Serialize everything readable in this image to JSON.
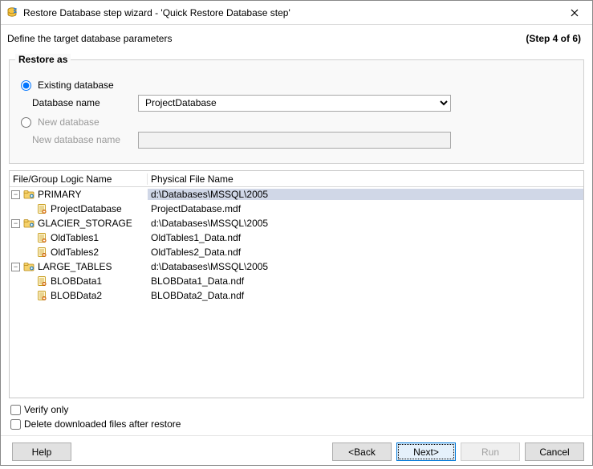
{
  "window": {
    "title": "Restore Database step wizard - 'Quick Restore Database step'"
  },
  "header": {
    "subtitle": "Define the target database parameters",
    "step_indicator": "(Step 4 of 6)"
  },
  "restore_as": {
    "legend": "Restore as",
    "existing_label": "Existing database",
    "existing_checked": true,
    "db_name_label": "Database name",
    "db_name_value": "ProjectDatabase",
    "new_label": "New database",
    "new_checked": false,
    "new_name_label": "New database name",
    "new_name_value": ""
  },
  "grid": {
    "header_col1": "File/Group Logic Name",
    "header_col2": "Physical File Name",
    "rows": [
      {
        "level": 0,
        "expand": "−",
        "icon": "folder",
        "name": "PRIMARY",
        "path": "d:\\Databases\\MSSQL\\2005",
        "selected": true
      },
      {
        "level": 1,
        "expand": "",
        "icon": "file",
        "name": "ProjectDatabase",
        "path": "ProjectDatabase.mdf",
        "selected": false
      },
      {
        "level": 0,
        "expand": "−",
        "icon": "folder",
        "name": "GLACIER_STORAGE",
        "path": "d:\\Databases\\MSSQL\\2005",
        "selected": false
      },
      {
        "level": 1,
        "expand": "",
        "icon": "file",
        "name": "OldTables1",
        "path": "OldTables1_Data.ndf",
        "selected": false
      },
      {
        "level": 1,
        "expand": "",
        "icon": "file",
        "name": "OldTables2",
        "path": "OldTables2_Data.ndf",
        "selected": false
      },
      {
        "level": 0,
        "expand": "−",
        "icon": "folder",
        "name": "LARGE_TABLES",
        "path": "d:\\Databases\\MSSQL\\2005",
        "selected": false
      },
      {
        "level": 1,
        "expand": "",
        "icon": "file",
        "name": "BLOBData1",
        "path": "BLOBData1_Data.ndf",
        "selected": false
      },
      {
        "level": 1,
        "expand": "",
        "icon": "file",
        "name": "BLOBData2",
        "path": "BLOBData2_Data.ndf",
        "selected": false
      }
    ]
  },
  "options": {
    "verify_only_label": "Verify only",
    "verify_only_checked": false,
    "delete_files_label": "Delete downloaded files after restore",
    "delete_files_checked": false
  },
  "buttons": {
    "help": "Help",
    "back": "<Back",
    "next": "Next>",
    "run": "Run",
    "cancel": "Cancel"
  }
}
